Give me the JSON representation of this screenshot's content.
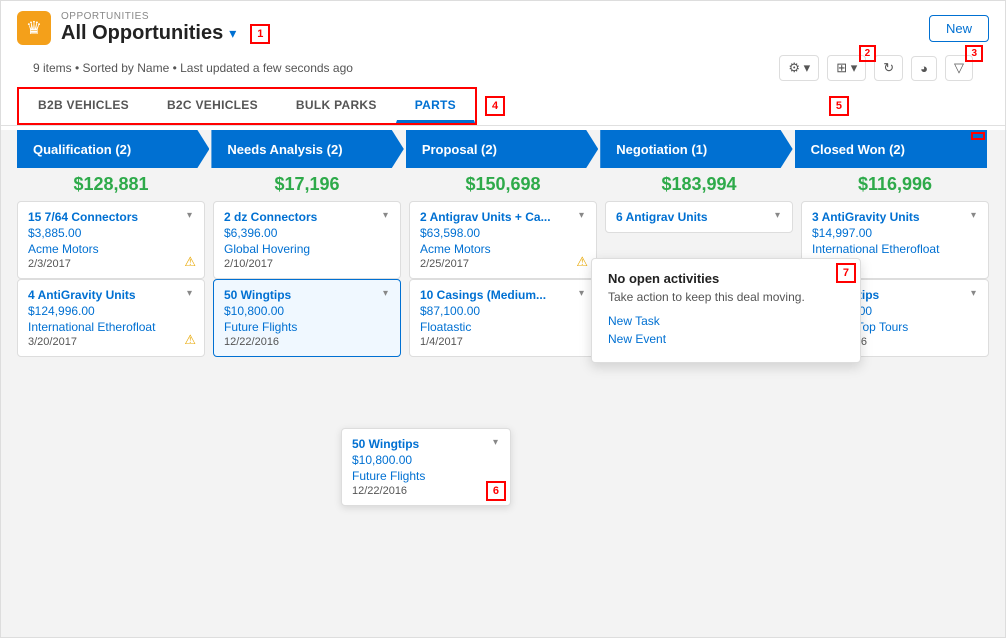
{
  "header": {
    "label": "OPPORTUNITIES",
    "title": "All Opportunities",
    "new_button": "New",
    "status": "9 items • Sorted by Name • Last updated a few seconds ago"
  },
  "tabs": {
    "items": [
      "B2B VEHICLES",
      "B2C VEHICLES",
      "BULK PARKS",
      "PARTS"
    ]
  },
  "stages": [
    {
      "name": "Qualification",
      "count": 2,
      "total": "$128,881"
    },
    {
      "name": "Needs Analysis",
      "count": 2,
      "total": "$17,196"
    },
    {
      "name": "Proposal",
      "count": 2,
      "total": "$150,698"
    },
    {
      "name": "Negotiation",
      "count": 1,
      "total": "$183,994"
    },
    {
      "name": "Closed Won",
      "count": 2,
      "total": "$116,996"
    }
  ],
  "cards": {
    "qualification": [
      {
        "title": "15 7/64 Connectors",
        "price": "$3,885.00",
        "company": "Acme Motors",
        "date": "2/3/2017",
        "warn": true
      },
      {
        "title": "4 AntiGravity Units",
        "price": "$124,996.00",
        "company": "International Etherofloat",
        "date": "3/20/2017",
        "warn": true
      }
    ],
    "needs_analysis": [
      {
        "title": "2 dz Connectors",
        "price": "$6,396.00",
        "company": "Global Hovering",
        "date": "2/10/2017",
        "warn": false
      },
      {
        "title": "50 Wingtips",
        "price": "$10,800.00",
        "company": "Future Flights",
        "date": "12/22/2016",
        "warn": false,
        "highlighted": true
      }
    ],
    "proposal": [
      {
        "title": "2 Antigrav Units + Ca...",
        "price": "$63,598.00",
        "company": "Acme Motors",
        "date": "2/25/2017",
        "warn": true
      },
      {
        "title": "10 Casings (Medium...",
        "price": "$87,100.00",
        "company": "Floatastic",
        "date": "1/4/2017",
        "warn": false
      }
    ],
    "negotiation": [
      {
        "title": "6 Antigrav Units",
        "price": "",
        "company": "",
        "date": "",
        "warn": false
      }
    ],
    "closed_won": [
      {
        "title": "3 AntiGravity Units",
        "price": "$14,997.00",
        "company": "International Etherofloat",
        "date": "2016",
        "warn": false
      },
      {
        "title": "50 Wingtips",
        "price": "$14,999.00",
        "company": "Canyon Top Tours",
        "date": "12/22/2016",
        "warn": false
      }
    ]
  },
  "tooltip": {
    "title": "No open activities",
    "subtitle": "Take action to keep this deal moving.",
    "new_task": "New Task",
    "new_event": "New Event"
  },
  "floating_card": {
    "title": "50 Wingtips",
    "price": "$10,800.00",
    "company": "Future Flights",
    "date": "12/22/2016"
  },
  "ref_numbers": {
    "r1": "1",
    "r2": "2",
    "r3": "3",
    "r4": "4",
    "r5": "5",
    "r6": "6",
    "r7": "7"
  }
}
